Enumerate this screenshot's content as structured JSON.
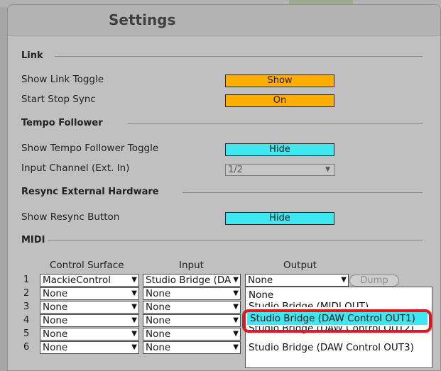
{
  "window": {
    "title": "Settings"
  },
  "link": {
    "section_title": "Link",
    "show_link_toggle": {
      "label": "Show Link Toggle",
      "value": "Show"
    },
    "start_stop_sync": {
      "label": "Start Stop Sync",
      "value": "On"
    }
  },
  "tempo_follower": {
    "section_title": "Tempo Follower",
    "show_toggle": {
      "label": "Show Tempo Follower Toggle",
      "value": "Hide"
    },
    "input_channel": {
      "label": "Input Channel (Ext. In)",
      "value": "1/2"
    }
  },
  "resync": {
    "section_title": "Resync External Hardware",
    "show_button": {
      "label": "Show Resync Button",
      "value": "Hide"
    }
  },
  "midi": {
    "section_title": "MIDI",
    "headers": {
      "control_surface": "Control Surface",
      "input": "Input",
      "output": "Output"
    },
    "rows": [
      {
        "num": "1",
        "control_surface": "MackieControl",
        "input": "Studio Bridge (DA",
        "output": "None",
        "dump": "Dump"
      },
      {
        "num": "2",
        "control_surface": "None",
        "input": "None"
      },
      {
        "num": "3",
        "control_surface": "None",
        "input": "None"
      },
      {
        "num": "4",
        "control_surface": "None",
        "input": "None"
      },
      {
        "num": "5",
        "control_surface": "None",
        "input": "None"
      },
      {
        "num": "6",
        "control_surface": "None",
        "input": "None"
      }
    ],
    "output_menu": {
      "items": [
        "None",
        "Studio Bridge (MIDI OUT)",
        "Studio Bridge (DAW Control OUT1)",
        "Studio Bridge (DAW Control OUT2)",
        "Studio Bridge (DAW Control OUT3)"
      ],
      "highlighted_index": 2
    }
  },
  "colors": {
    "orange": "#ffad00",
    "cyan": "#3ee8f0",
    "highlight_ring": "#e3161d",
    "window_bg": "#c0c0c0"
  },
  "icons": {
    "dropdown_arrow": "dropdown-arrow-icon"
  }
}
